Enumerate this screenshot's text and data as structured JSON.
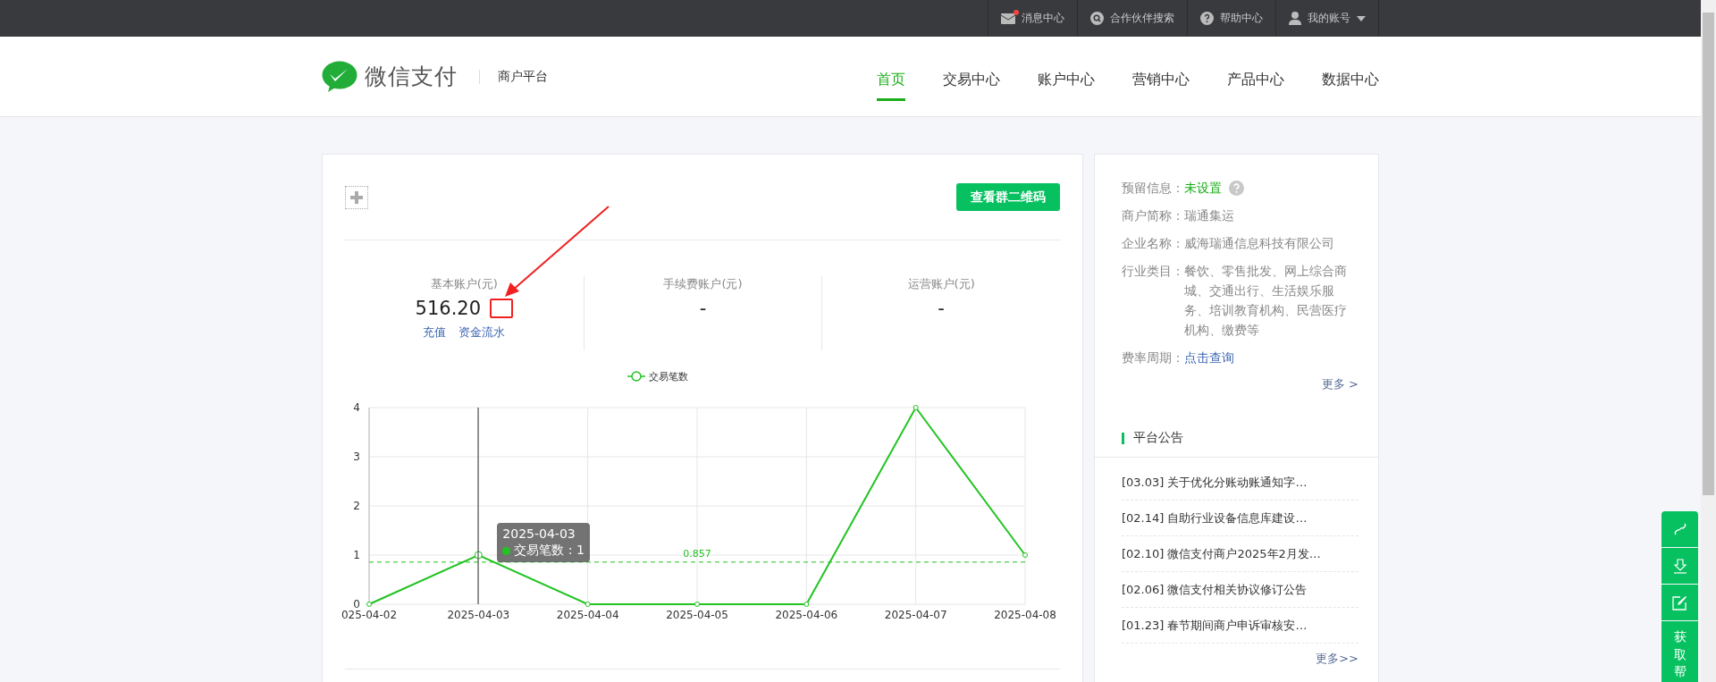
{
  "top_bar": {
    "items": [
      {
        "kind": "mail",
        "label": "消息中心",
        "badge": true
      },
      {
        "kind": "search",
        "label": "合作伙伴搜索",
        "badge": false
      },
      {
        "kind": "help",
        "label": "帮助中心",
        "badge": false
      },
      {
        "kind": "user",
        "label": "我的账号",
        "badge": false
      }
    ]
  },
  "header": {
    "logo": "微信支付",
    "platform": "商户平台",
    "nav": [
      {
        "label": "首页",
        "selected": true
      },
      {
        "label": "交易中心",
        "selected": false
      },
      {
        "label": "账户中心",
        "selected": false
      },
      {
        "label": "营销中心",
        "selected": false
      },
      {
        "label": "产品中心",
        "selected": false
      },
      {
        "label": "数据中心",
        "selected": false
      }
    ]
  },
  "main": {
    "qr_button": "查看群二维码",
    "accounts": [
      {
        "title": "基本账户(元)",
        "amount": "516.20",
        "links": [
          "充值",
          "资金流水"
        ]
      },
      {
        "title": "手续费账户(元)",
        "amount": "-"
      },
      {
        "title": "运营账户(元)",
        "amount": "-"
      }
    ],
    "chart": {
      "tooltip": {
        "title": "2025-04-03",
        "text": "交易笔数 : 1"
      },
      "hover_points": [
        {
          "selected": false
        },
        {
          "selected": true
        },
        {
          "selected": false
        },
        {
          "selected": false
        },
        {
          "selected": false
        },
        {
          "selected": false
        },
        {
          "selected": false
        }
      ],
      "chart_data": {
        "type": "line",
        "categories": [
          "025-04-02",
          "2025-04-03",
          "2025-04-04",
          "2025-04-05",
          "2025-04-06",
          "2025-04-07",
          "2025-04-08"
        ],
        "series": [
          {
            "name": "交易笔数",
            "color": "#22c322",
            "marker": "circle",
            "values": [
              0,
              1,
              0,
              0,
              0,
              4,
              1
            ]
          }
        ],
        "ylim": [
          0,
          4
        ],
        "yticks": [
          0,
          1,
          2,
          3,
          4
        ],
        "grid": true,
        "ref_lines": [
          {
            "axis": "y",
            "value": 0.857,
            "label": "0.857"
          }
        ]
      }
    }
  },
  "side": {
    "info": [
      {
        "label": "预留信息：",
        "value": "未设置",
        "kind": "status"
      },
      {
        "label": "商户简称：",
        "value": "瑞通集运",
        "kind": "text"
      },
      {
        "label": "企业名称：",
        "value": "威海瑞通信息科技有限公司",
        "kind": "text"
      },
      {
        "label": "行业类目：",
        "value": "餐饮、零售批发、网上综合商城、交通出行、生活娱乐服务、培训教育机构、民营医疗机构、缴费等",
        "kind": "text"
      },
      {
        "label": "费率周期：",
        "value": "点击查询",
        "kind": "link"
      }
    ],
    "more": "更多 >",
    "notices_title": "平台公告",
    "notices": [
      "[03.03] 关于优化分账动账通知字…",
      "[02.14] 自助行业设备信息库建设…",
      "[02.10] 微信支付商户2025年2月发…",
      "[02.06] 微信支付相关协议修订公告",
      "[01.23] 春节期间商户申诉审核安…"
    ],
    "notices_more": "更多>>"
  },
  "float_buttons": [
    {
      "kind": "link"
    },
    {
      "kind": "download"
    },
    {
      "kind": "edit"
    },
    {
      "kind": "text",
      "label": "获取帮"
    }
  ]
}
